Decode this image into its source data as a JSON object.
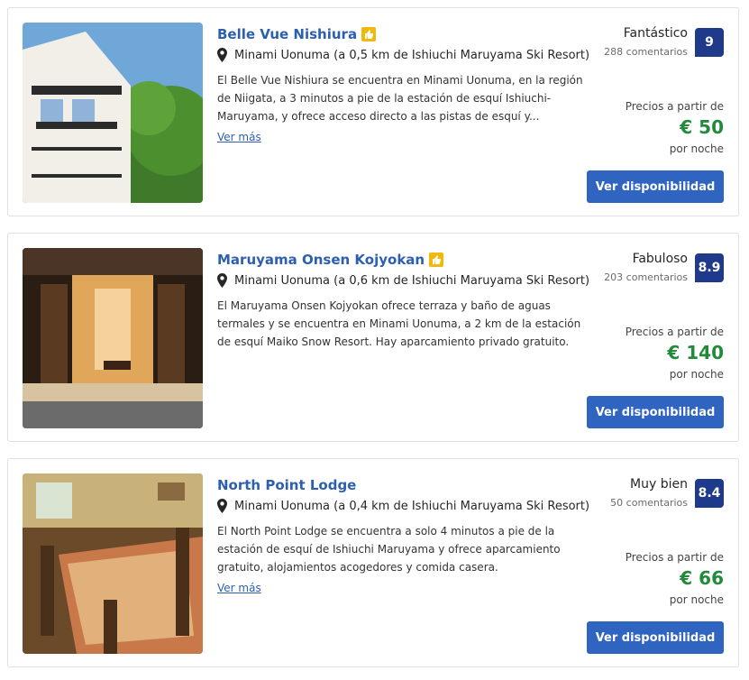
{
  "listings": [
    {
      "name": "Belle Vue Nishiura",
      "location": "Minami Uonuma (a 0,5 km de Ishiuchi Maruyama Ski Resort)",
      "description": "El Belle Vue Nishiura se encuentra en Minami Uonuma, en la región de Niigata, a 3 minutos a pie de la estación de esquí Ishiuchi-Maruyama, y ofrece acceso directo a las pistas de esquí y...",
      "more_link": "Ver más",
      "rating_word": "Fantástico",
      "reviews": "288 comentarios",
      "score": "9",
      "price_from": "Precios a partir de",
      "price": "€ 50",
      "per_night": "por noche",
      "cta": "Ver disponibilidad",
      "has_thumb_badge": true,
      "has_more_link": true
    },
    {
      "name": "Maruyama Onsen Kojyokan",
      "location": "Minami Uonuma (a 0,6 km de Ishiuchi Maruyama Ski Resort)",
      "description": "El Maruyama Onsen Kojyokan ofrece terraza y baño de aguas termales y se encuentra en Minami Uonuma, a 2 km de la estación de esquí Maiko Snow Resort. Hay aparcamiento privado gratuito.",
      "more_link": "",
      "rating_word": "Fabuloso",
      "reviews": "203 comentarios",
      "score": "8.9",
      "price_from": "Precios a partir de",
      "price": "€ 140",
      "per_night": "por noche",
      "cta": "Ver disponibilidad",
      "has_thumb_badge": true,
      "has_more_link": false
    },
    {
      "name": "North Point Lodge",
      "location": "Minami Uonuma (a 0,4 km de Ishiuchi Maruyama Ski Resort)",
      "description": "El North Point Lodge se encuentra a solo 4 minutos a pie de la estación de esquí de Ishiuchi Maruyama y ofrece aparcamiento gratuito, alojamientos acogedores y comida casera.",
      "more_link": "Ver más",
      "rating_word": "Muy bien",
      "reviews": "50 comentarios",
      "score": "8.4",
      "price_from": "Precios a partir de",
      "price": "€ 66",
      "per_night": "por noche",
      "cta": "Ver disponibilidad",
      "has_thumb_badge": false,
      "has_more_link": true
    }
  ],
  "colors": {
    "title": "#2d5fb0",
    "score_bg": "#1f3a8a",
    "price": "#218a3b",
    "button": "#2f64c0",
    "badge": "#f0b90b"
  },
  "icons": {
    "location": "map-pin-icon",
    "badge": "thumbs-up-icon"
  }
}
